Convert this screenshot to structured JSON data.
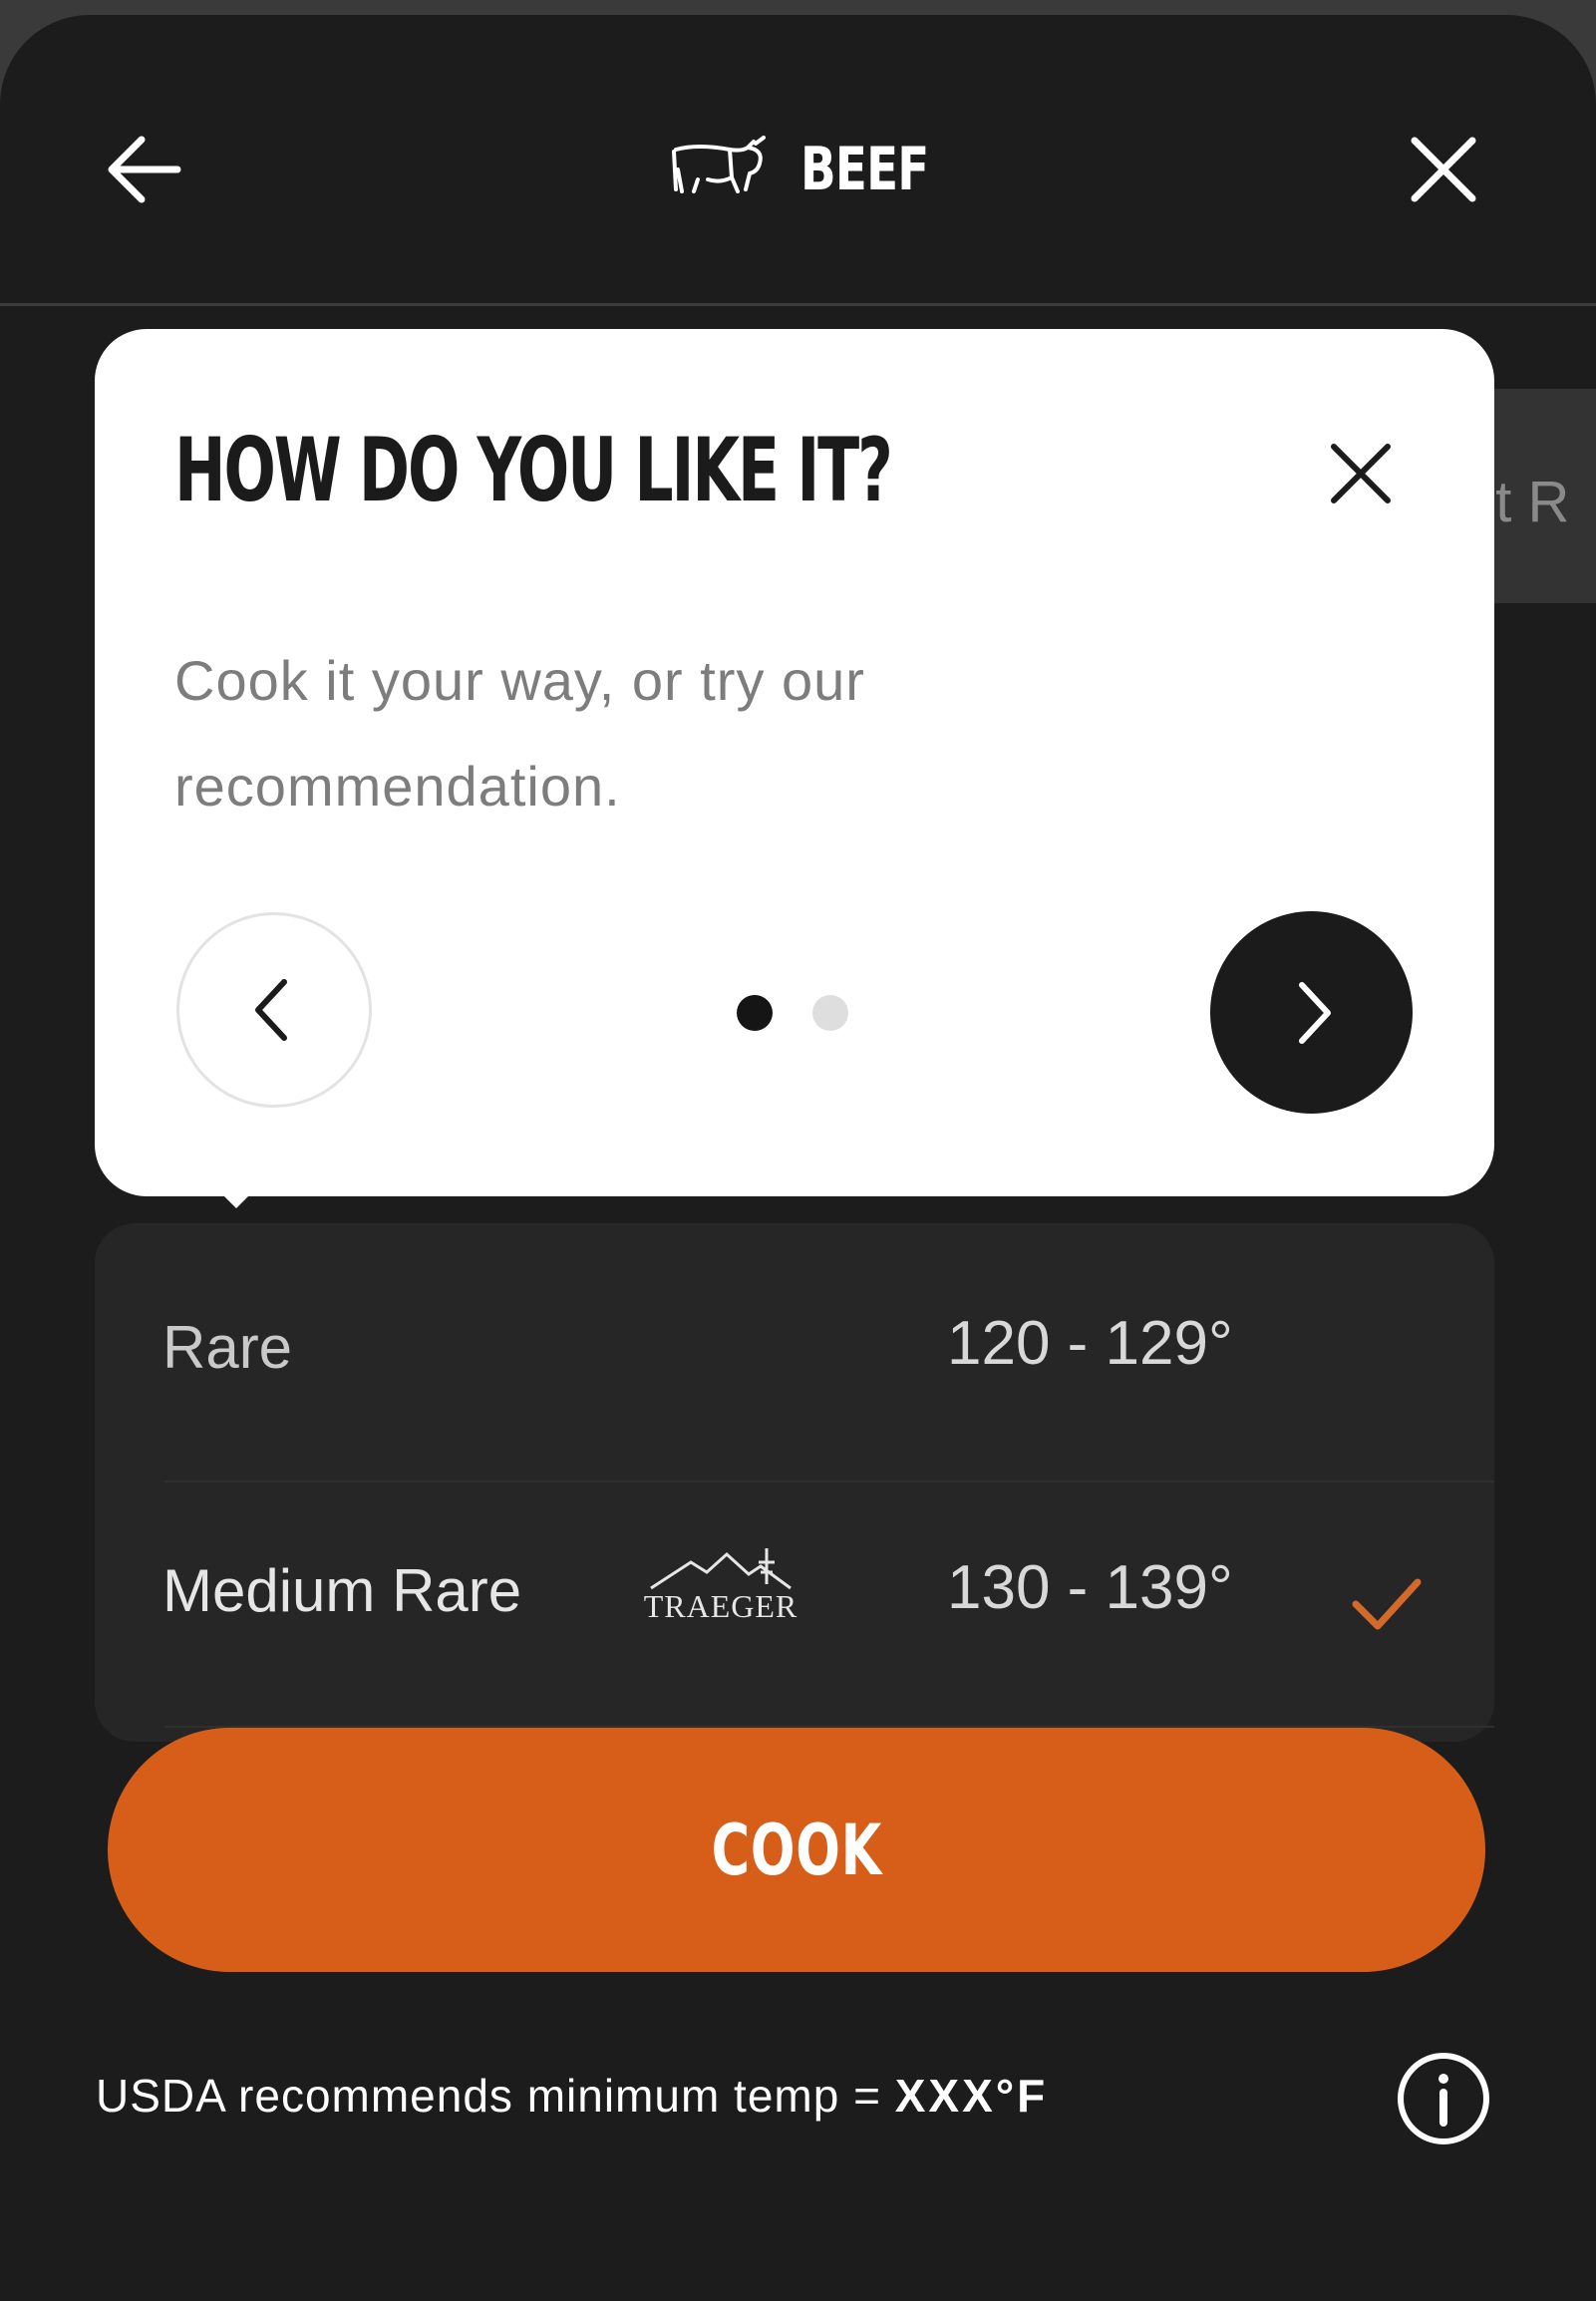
{
  "header": {
    "title": "BEEF",
    "icons": {
      "back": "arrow-left-icon",
      "category": "cow-icon",
      "close": "close-icon"
    }
  },
  "background_chip": {
    "partial_text": "ot R"
  },
  "popover": {
    "title": "HOW DO YOU LIKE IT?",
    "body": "Cook it your way, or try our recommendation.",
    "pagination": {
      "current": 1,
      "total": 2
    },
    "icons": {
      "close": "close-icon",
      "prev": "chevron-left-icon",
      "next": "chevron-right-icon"
    }
  },
  "doneness": {
    "rows": [
      {
        "label": "Rare",
        "range": "120 - 129°",
        "selected": false
      },
      {
        "label": "Medium Rare",
        "badge": "TRAEGER",
        "range": "130 - 139°",
        "selected": true
      }
    ],
    "selected_color": "#d46a2a"
  },
  "cook_button": {
    "label": "COOK",
    "color": "#d75e18"
  },
  "footer": {
    "usda_text": "USDA recommends minimum temp = ",
    "usda_value": "XXX°F",
    "info_icon": "info-icon"
  }
}
